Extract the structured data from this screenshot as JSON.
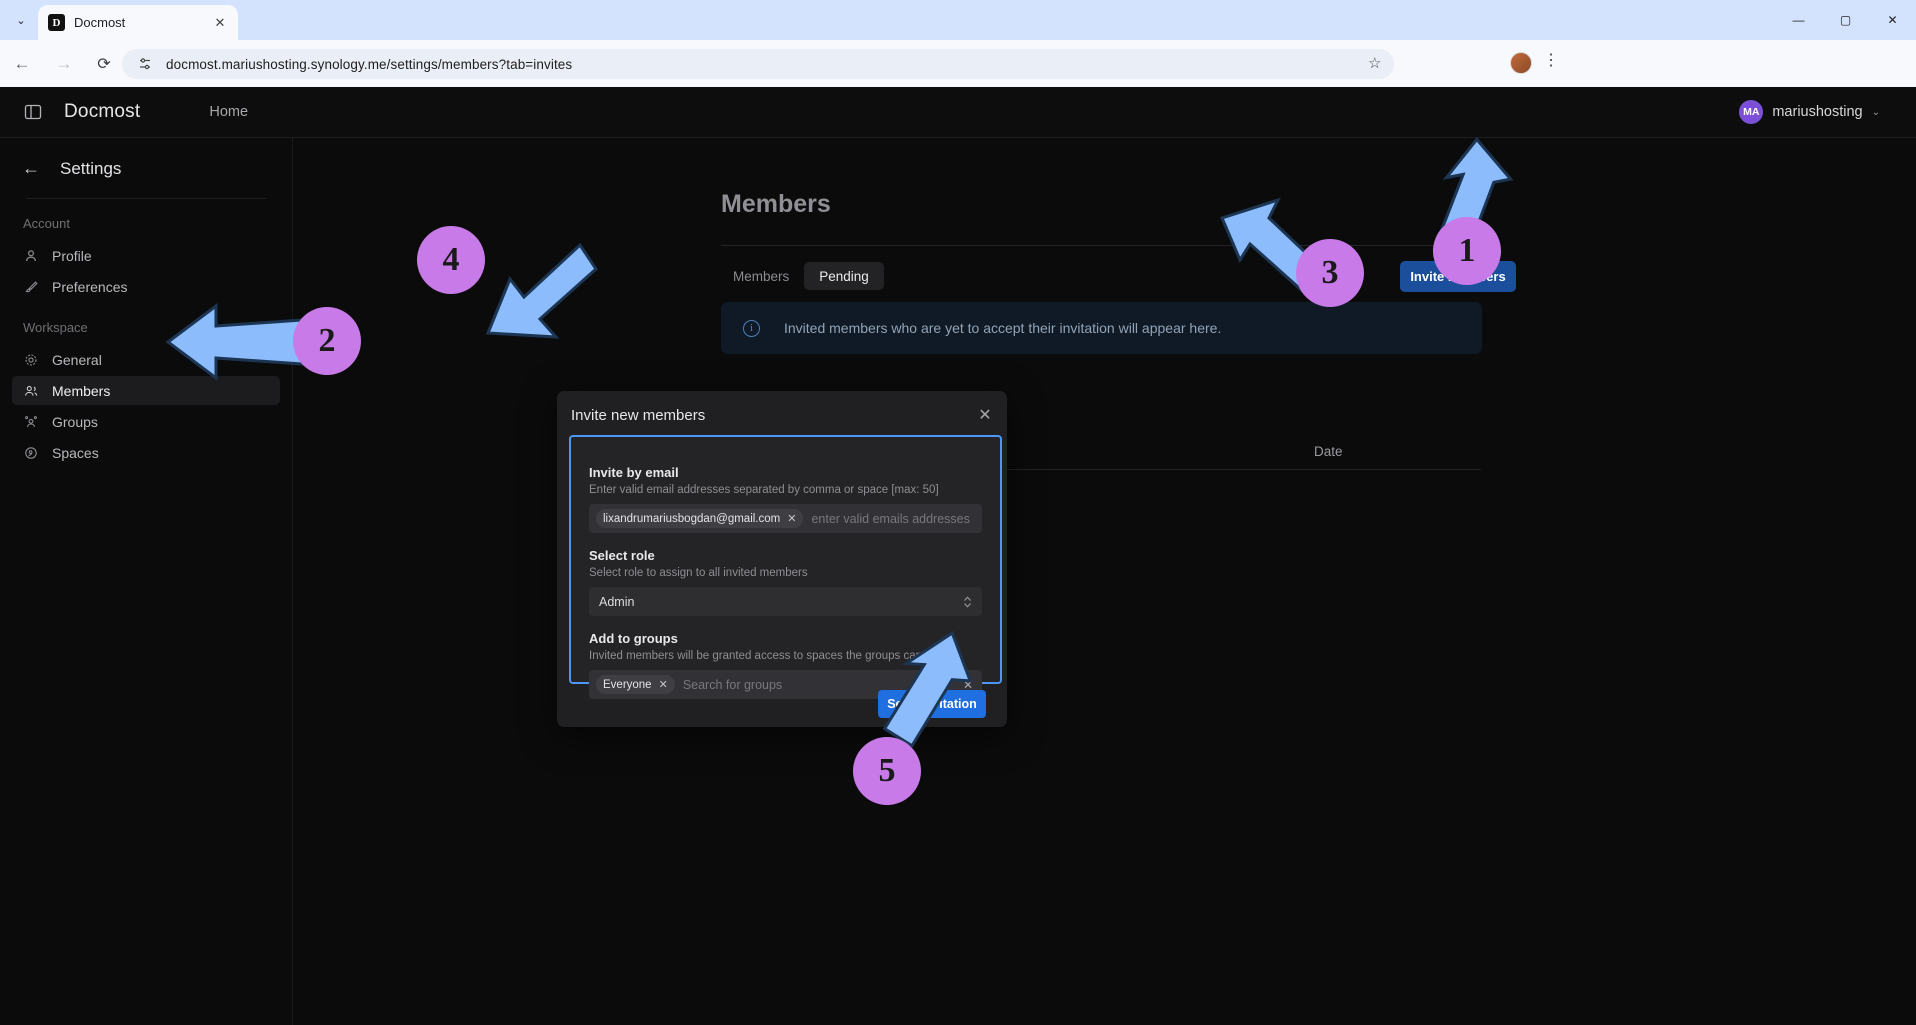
{
  "browser": {
    "tab": {
      "title": "Docmost",
      "favicon_letter": "D",
      "close_icon": "✕"
    },
    "chevron_icon": "⌄",
    "nav": {
      "back_icon": "←",
      "forward_icon": "→",
      "reload_icon": "⟳"
    },
    "omnibox": {
      "site_settings_icon": "⚙",
      "url": "docmost.mariushosting.synology.me/settings/members?tab=invites"
    },
    "bookmark_icon": "☆",
    "menu_icon": "⋮",
    "window": {
      "minimize": "—",
      "maximize": "▢",
      "close": "✕"
    }
  },
  "app": {
    "sidebar_toggle_icon": "▣",
    "brand": "Docmost",
    "nav_home": "Home",
    "user": {
      "initials": "MA",
      "name": "mariushosting",
      "caret_icon": "⌄"
    }
  },
  "sidebar": {
    "back_icon": "←",
    "title": "Settings",
    "groups": [
      {
        "label": "Account",
        "items": [
          {
            "label": "Profile",
            "icon": "user-icon",
            "glyph": "○",
            "active": false
          },
          {
            "label": "Preferences",
            "icon": "brush-icon",
            "glyph": "✎",
            "active": false
          }
        ]
      },
      {
        "label": "Workspace",
        "items": [
          {
            "label": "General",
            "icon": "gear-icon",
            "glyph": "⚙",
            "active": false
          },
          {
            "label": "Members",
            "icon": "users-icon",
            "glyph": "≗",
            "active": true
          },
          {
            "label": "Groups",
            "icon": "group-icon",
            "glyph": "⁂",
            "active": false
          },
          {
            "label": "Spaces",
            "icon": "spaces-icon",
            "glyph": "◍",
            "active": false
          }
        ]
      }
    ]
  },
  "main": {
    "page_title": "Members",
    "tabs": [
      {
        "label": "Members",
        "active": false
      },
      {
        "label": "Pending",
        "active": true
      }
    ],
    "info_banner": {
      "icon": "info-icon",
      "glyph": "i",
      "text": "Invited members who are yet to accept their invitation will appear here."
    },
    "invite_button": "Invite members",
    "table_header_date": "Date"
  },
  "modal": {
    "title": "Invite new members",
    "close_icon": "✕",
    "email_section": {
      "label": "Invite by email",
      "hint": "Enter valid email addresses separated by comma or space [max: 50]",
      "pill": "lixandrumariusbogdan@gmail.com",
      "pill_remove_icon": "✕",
      "placeholder": "enter valid emails addresses"
    },
    "role_section": {
      "label": "Select role",
      "hint": "Select role to assign to all invited members",
      "value": "Admin",
      "caret_icon": "⌃⌄"
    },
    "groups_section": {
      "label": "Add to groups",
      "hint": "Invited members will be granted access to spaces the groups can access",
      "pill": "Everyone",
      "pill_remove_icon": "✕",
      "placeholder": "Search for groups",
      "clear_icon": "✕"
    },
    "send_button": "Send invitation"
  },
  "annotations": {
    "badges": [
      {
        "number": "1"
      },
      {
        "number": "2"
      },
      {
        "number": "3"
      },
      {
        "number": "4"
      },
      {
        "number": "5"
      }
    ],
    "arrow_color": "#8cbcfb",
    "badge_color": "#c77ae8"
  }
}
